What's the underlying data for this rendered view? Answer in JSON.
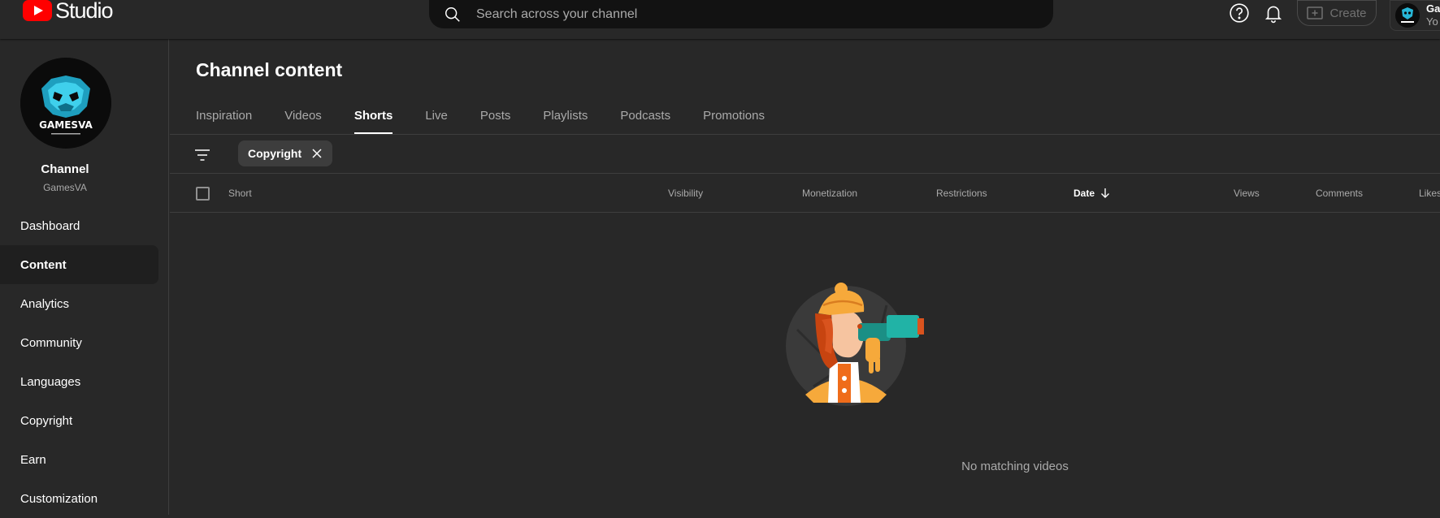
{
  "app": {
    "logo_text": "Studio"
  },
  "search": {
    "placeholder": "Search across your channel"
  },
  "header": {
    "create_label": "Create",
    "account_line1": "Ga",
    "account_line2": "Yo"
  },
  "sidebar": {
    "channel_label": "Channel",
    "channel_name": "GamesVA",
    "avatar_text": "GAMESVA",
    "items": [
      {
        "label": "Dashboard"
      },
      {
        "label": "Content"
      },
      {
        "label": "Analytics"
      },
      {
        "label": "Community"
      },
      {
        "label": "Languages"
      },
      {
        "label": "Copyright"
      },
      {
        "label": "Earn"
      },
      {
        "label": "Customization"
      }
    ],
    "active_item": "Content"
  },
  "main": {
    "title": "Channel content",
    "tabs": [
      {
        "label": "Inspiration"
      },
      {
        "label": "Videos"
      },
      {
        "label": "Shorts"
      },
      {
        "label": "Live"
      },
      {
        "label": "Posts"
      },
      {
        "label": "Playlists"
      },
      {
        "label": "Podcasts"
      },
      {
        "label": "Promotions"
      }
    ],
    "active_tab": "Shorts",
    "filter_chip": "Copyright",
    "columns": {
      "short": "Short",
      "visibility": "Visibility",
      "monetization": "Monetization",
      "restrictions": "Restrictions",
      "date": "Date",
      "views": "Views",
      "comments": "Comments",
      "likes": "Likes"
    },
    "sorted_column": "Date",
    "empty_message": "No matching videos"
  },
  "colors": {
    "accent": "#ff0000",
    "background": "#282828",
    "selected_nav": "#1f1f1f"
  }
}
